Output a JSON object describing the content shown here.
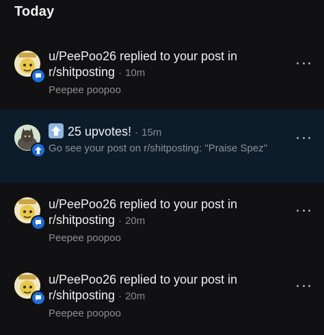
{
  "section": {
    "title": "Today"
  },
  "notifications": [
    {
      "title": "u/PeePoo26 replied to your post in r/shitposting",
      "separator": "·",
      "time": "10m",
      "body": "Peepee poopoo",
      "badge": "chat-bubble-icon"
    },
    {
      "title": "25 upvotes!",
      "separator": "·",
      "time": "15m",
      "body": "Go see your post on r/shitposting: \"Praise Spez\"",
      "badge": "upvote-arrow-icon"
    },
    {
      "title": "u/PeePoo26 replied to your post in r/shitposting",
      "separator": "·",
      "time": "20m",
      "body": "Peepee poopoo",
      "badge": "chat-bubble-icon"
    },
    {
      "title": "u/PeePoo26 replied to your post in r/shitposting",
      "separator": "·",
      "time": "20m",
      "body": "Peepee poopoo",
      "badge": "chat-bubble-icon"
    }
  ],
  "colors": {
    "background": "#111113",
    "highlight_row": "#0d1c2b",
    "badge_blue": "#1f6fd6",
    "secondary_text": "#8b8b90"
  }
}
